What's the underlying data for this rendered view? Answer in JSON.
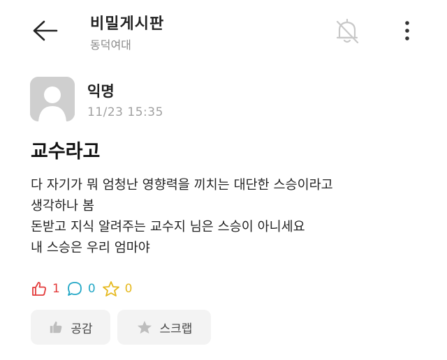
{
  "header": {
    "title": "비밀게시판",
    "subtitle": "동덕여대",
    "back_icon": "arrow-left-icon",
    "notification_icon": "bell-off-icon",
    "more_icon": "more-vertical-icon"
  },
  "post": {
    "author": "익명",
    "timestamp": "11/23 15:35",
    "title": "교수라고",
    "body_lines": [
      "다 자기가 뭐 엄청난 영향력을 끼치는 대단한 스승이라고",
      "생각하나 봄",
      "돈받고 지식 알려주는 교수지 님은 스승이 아니세요",
      "내 스승은 우리 엄마야"
    ],
    "stats": {
      "likes": "1",
      "comments": "0",
      "scraps": "0"
    }
  },
  "actions": {
    "like_label": "공감",
    "scrap_label": "스크랩"
  },
  "colors": {
    "like": "#e33a3a",
    "comment": "#22a7c6",
    "scrap": "#e6b91f",
    "button_bg": "#f3f3f3",
    "muted_text": "#8a8a8a"
  }
}
